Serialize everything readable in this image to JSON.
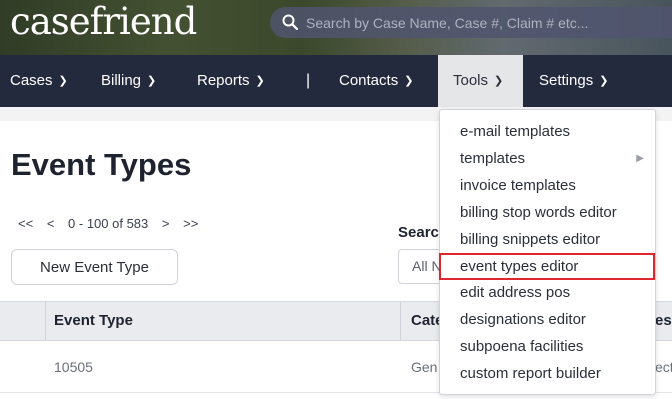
{
  "header": {
    "logo": "casefriend",
    "search_placeholder": "Search by Case Name, Case #, Claim # etc..."
  },
  "nav": {
    "items": [
      {
        "label": "Cases"
      },
      {
        "label": "Billing"
      },
      {
        "label": "Reports"
      },
      {
        "label": "Contacts"
      },
      {
        "label": "Tools"
      },
      {
        "label": "Settings"
      }
    ],
    "separator": "|",
    "active": "Tools"
  },
  "page": {
    "title": "Event Types",
    "pager": {
      "first": "<<",
      "prev": "<",
      "range": "0 - 100 of 583",
      "next": ">",
      "last": ">>"
    },
    "search_label": "Searc",
    "filter_value": "All N",
    "new_button": "New Event Type",
    "table": {
      "headers": [
        "Event Type",
        "Cate",
        "esc"
      ],
      "rows": [
        [
          "10505",
          "Gen",
          "ecti"
        ]
      ]
    }
  },
  "tools_menu": {
    "items": [
      {
        "label": "e-mail templates"
      },
      {
        "label": "templates",
        "submenu": "▶"
      },
      {
        "label": "invoice templates"
      },
      {
        "label": "billing stop words editor"
      },
      {
        "label": "billing snippets editor"
      },
      {
        "label": "event types editor"
      },
      {
        "label": "edit address pos"
      },
      {
        "label": "designations editor"
      },
      {
        "label": "subpoena facilities"
      },
      {
        "label": "custom report builder"
      }
    ],
    "highlighted": "event types editor",
    "highlight_color": "#e0262d"
  }
}
